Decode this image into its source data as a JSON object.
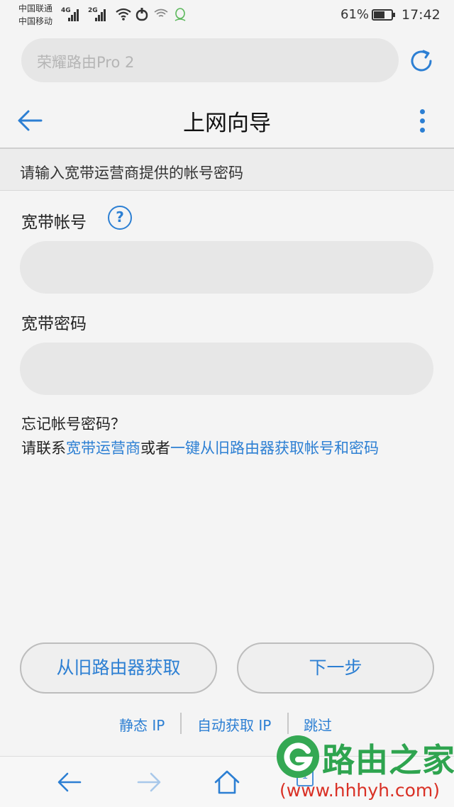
{
  "status_bar": {
    "carrier_1": "中国联通",
    "carrier_2": "中国移动",
    "net_1": "4G",
    "net_2": "2G",
    "battery_percent": "61%",
    "battery_level": 0.61,
    "time": "17:42"
  },
  "url_bar": {
    "text": "荣耀路由Pro 2"
  },
  "header": {
    "title": "上网向导"
  },
  "hint": "请输入宽带运营商提供的帐号密码",
  "form": {
    "account_label": "宽带帐号",
    "help_symbol": "?",
    "account_value": "",
    "password_label": "宽带密码",
    "password_value": ""
  },
  "forgot": {
    "question": "忘记帐号密码？",
    "prefix": "请联系",
    "isp_link": "宽带运营商",
    "middle": "或者",
    "router_link": "一键从旧路由器获取帐号和密码"
  },
  "buttons": {
    "get_from_old": "从旧路由器获取",
    "next": "下一步"
  },
  "bottom_links": {
    "static_ip": "静态 IP",
    "auto_ip": "自动获取 IP",
    "skip": "跳过"
  },
  "nav": {
    "tabs_count": "1"
  },
  "watermark": {
    "title": "路由之家",
    "url": "(www.hhhyh.com)"
  },
  "colors": {
    "accent": "#2c7fd3",
    "background": "#f4f4f4",
    "input_bg": "#e7e7e7",
    "watermark_green": "#2ea44f",
    "watermark_red": "#d93025"
  },
  "icons": [
    "signal-icon",
    "wifi-icon",
    "refresh-icon",
    "back-arrow-icon",
    "more-vertical-icon",
    "help-icon",
    "nav-back-icon",
    "nav-forward-icon",
    "nav-home-icon",
    "nav-tabs-icon"
  ]
}
